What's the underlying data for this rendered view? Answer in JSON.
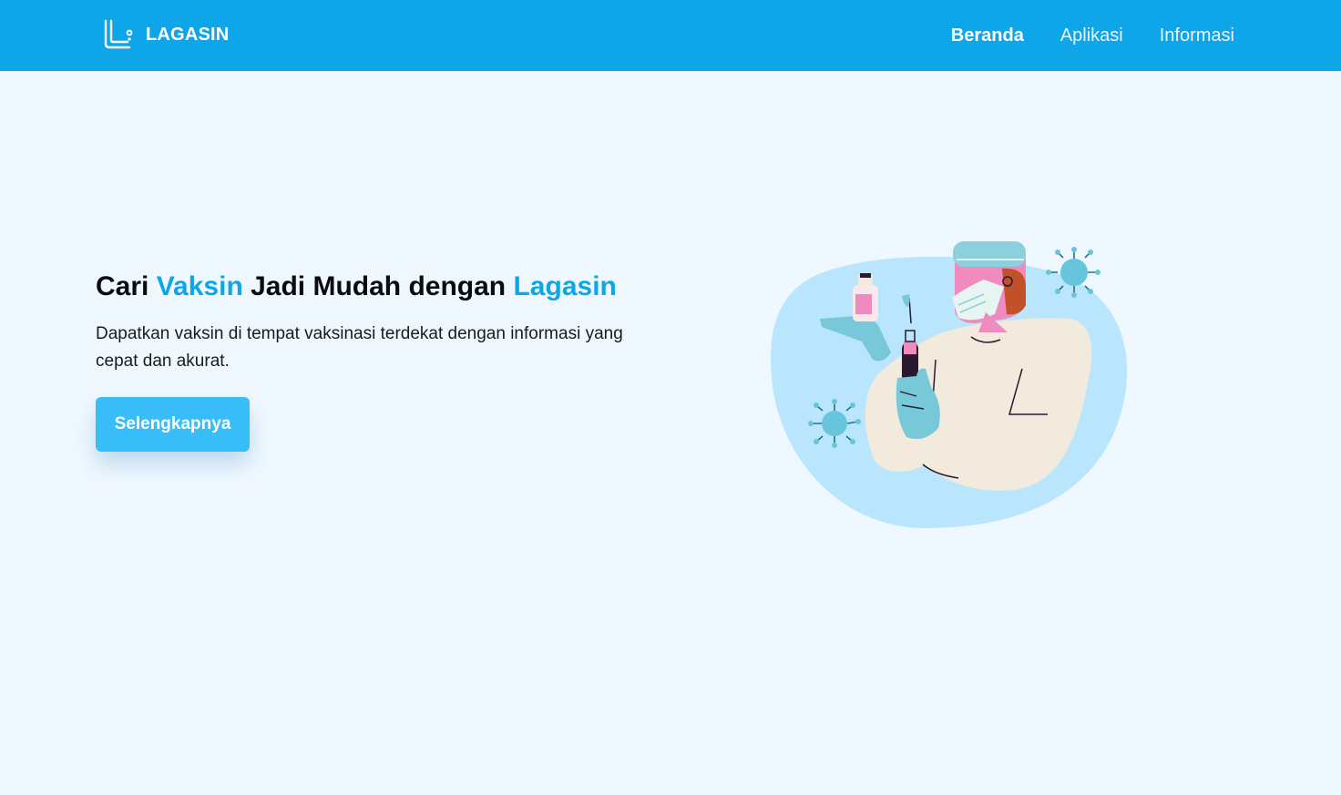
{
  "header": {
    "brand": "LAGASIN",
    "nav": [
      {
        "label": "Beranda",
        "active": true
      },
      {
        "label": "Aplikasi",
        "active": false
      },
      {
        "label": "Informasi",
        "active": false
      }
    ]
  },
  "hero": {
    "title": {
      "part1": "Cari ",
      "accent1": "Vaksin",
      "part2": " Jadi Mudah dengan ",
      "accent2": "Lagasin"
    },
    "description": "Dapatkan vaksin di tempat vaksinasi terdekat dengan informasi yang cepat dan akurat.",
    "cta_label": "Selengkapnya"
  },
  "colors": {
    "primary": "#0ea5e9",
    "button": "#38bdf8",
    "background": "#f0f8ff",
    "blob": "#bae6fd"
  },
  "icons": {
    "logo": "lagasin-logo-icon",
    "illustration": "vaccine-doctor-illustration"
  }
}
